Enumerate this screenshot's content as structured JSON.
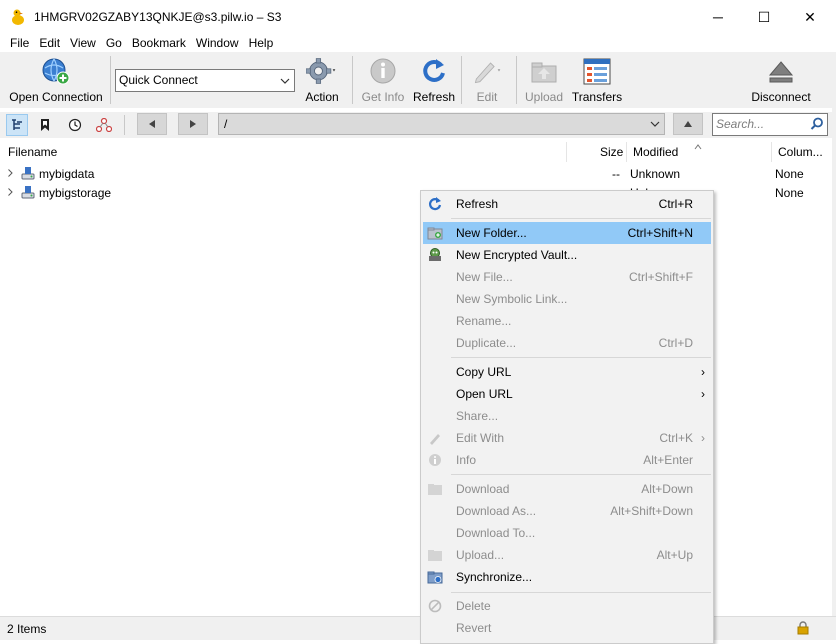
{
  "window": {
    "title": "1HMGRV02GZABY13QNKJE@s3.pilw.io – S3",
    "minimize_glyph": "─",
    "maximize_glyph": "☐",
    "close_glyph": "✕"
  },
  "menu": [
    "File",
    "Edit",
    "View",
    "Go",
    "Bookmark",
    "Window",
    "Help"
  ],
  "toolbar": {
    "open_connection": "Open Connection",
    "quick_connect": "Quick Connect",
    "action": "Action",
    "get_info": "Get Info",
    "refresh": "Refresh",
    "edit": "Edit",
    "upload": "Upload",
    "transfers": "Transfers",
    "disconnect": "Disconnect"
  },
  "navbar": {
    "path": "/",
    "search_placeholder": "Search..."
  },
  "columns": {
    "filename": "Filename",
    "size": "Size",
    "modified": "Modified",
    "columns": "Colum..."
  },
  "files": [
    {
      "name": "mybigdata",
      "size": "--",
      "modified": "Unknown",
      "extra": "None"
    },
    {
      "name": "mybigstorage",
      "size": "--",
      "modified": "Unknown",
      "extra": "None"
    }
  ],
  "status": {
    "items": "2 Items"
  },
  "context_menu": {
    "refresh": {
      "label": "Refresh",
      "shortcut": "Ctrl+R"
    },
    "new_folder": {
      "label": "New Folder...",
      "shortcut": "Ctrl+Shift+N"
    },
    "new_vault": {
      "label": "New Encrypted Vault..."
    },
    "new_file": {
      "label": "New File...",
      "shortcut": "Ctrl+Shift+F"
    },
    "new_symlink": {
      "label": "New Symbolic Link..."
    },
    "rename": {
      "label": "Rename..."
    },
    "duplicate": {
      "label": "Duplicate...",
      "shortcut": "Ctrl+D"
    },
    "copy_url": {
      "label": "Copy URL"
    },
    "open_url": {
      "label": "Open URL"
    },
    "share": {
      "label": "Share..."
    },
    "edit_with": {
      "label": "Edit With",
      "shortcut": "Ctrl+K"
    },
    "info": {
      "label": "Info",
      "shortcut": "Alt+Enter"
    },
    "download": {
      "label": "Download",
      "shortcut": "Alt+Down"
    },
    "download_as": {
      "label": "Download As...",
      "shortcut": "Alt+Shift+Down"
    },
    "download_to": {
      "label": "Download To..."
    },
    "upload": {
      "label": "Upload...",
      "shortcut": "Alt+Up"
    },
    "synchronize": {
      "label": "Synchronize..."
    },
    "delete": {
      "label": "Delete"
    },
    "revert": {
      "label": "Revert"
    },
    "submenu_glyph": "›"
  },
  "colors": {
    "highlight": "#91c9f7",
    "toolbar_bg": "#f0f0f0",
    "accent_blue": "#2d6fc7"
  }
}
